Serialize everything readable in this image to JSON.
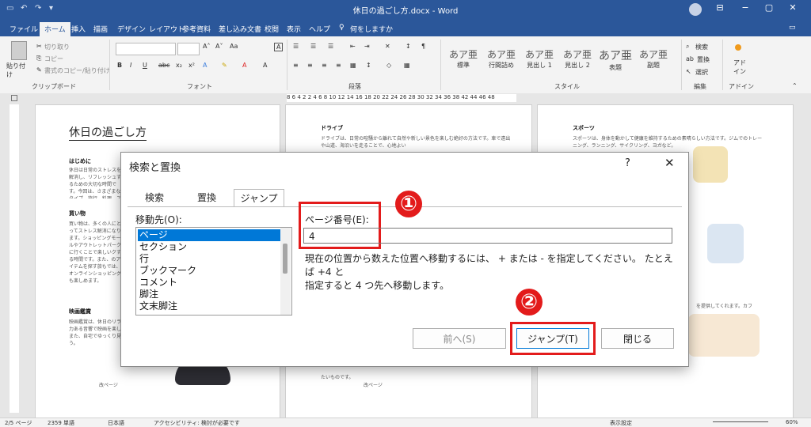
{
  "titlebar": {
    "title": "休日の過ごし方.docx - Word",
    "save_icon": "save-icon",
    "controls": [
      "?",
      "⊟",
      "−",
      "▢",
      "✕"
    ]
  },
  "ribbon_tabs": [
    "ファイル",
    "ホーム",
    "挿入",
    "描画",
    "デザイン",
    "レイアウト",
    "参考資料",
    "差し込み文書",
    "校閲",
    "表示",
    "ヘルプ",
    "何をしますか"
  ],
  "ribbon": {
    "clipboard": {
      "paste": "貼り付け",
      "cut": "切り取り",
      "copy": "コピー",
      "format_painter": "書式のコピー/貼り付け",
      "label": "クリップボード"
    },
    "font": {
      "label": "フォント"
    },
    "paragraph": {
      "label": "段落"
    },
    "styles": {
      "label": "スタイル",
      "items": [
        {
          "sample": "あア亜",
          "name": "標準"
        },
        {
          "sample": "あア亜",
          "name": "行間詰め"
        },
        {
          "sample": "あア亜",
          "name": "見出し 1"
        },
        {
          "sample": "あア亜",
          "name": "見出し 2"
        },
        {
          "sample": "あア亜",
          "name": "表題"
        },
        {
          "sample": "あア亜",
          "name": "副題"
        }
      ]
    },
    "editing": {
      "find": "検索",
      "replace": "置換",
      "select": "選択",
      "label": "編集"
    },
    "addin": {
      "label": "アドイン",
      "name": "アド イン"
    }
  },
  "ruler_numbers": "8 6 4 2   2 4 6 8 10 12 14 16 18 20 22 24 26 28 30 32 34 36 38   42 44 46 48",
  "pages": {
    "left": {
      "title": "休日の過ごし方",
      "h1": "はじめに",
      "p1": "休日は日常のストレスを解消し、リフレッシュするための大切な時間です。今回は、さまざまなタイプ、旅行、料理、スポーツなど、様々な休日の過ごし方をご紹介します。",
      "h2": "買い物",
      "p2": "買い物は、多くの人にとってストレス解消になります。ショッピングモールやアウトレットパークに行くことで楽しいクする時間です。また、のアイテムを探す旅もでは、オンラインショッピングも楽しめます。",
      "h3": "映画鑑賞",
      "p3": "映画鑑賞は、休日のリラックスに最適です。力ある音響で映画を楽しむことができます。また、自宅でゆっくり見るのも良いでしょう。",
      "break": "改ページ"
    },
    "middle": {
      "h1": "ドライブ",
      "p1": "ドライブは、日常の喧騒から離れて自然や新しい景色を楽しむ絶好の方法です。車で遠出や山道、海沿いを走ることで、心地よい",
      "p2": "たいものです。",
      "break": "改ページ"
    },
    "right": {
      "h1": "スポーツ",
      "p1": "スポーツは、身体を動かして健康を維持するための素晴らしい方法です。ジムでのトレーニング、ランニング、サイクリング、ヨガなど。",
      "p2": "を提供してくれます。カフ"
    }
  },
  "dialog": {
    "title": "検索と置換",
    "help": "?",
    "close": "✕",
    "tabs": [
      "検索",
      "置換",
      "ジャンプ"
    ],
    "active_tab": "ジャンプ",
    "goto_label": "移動先(O):",
    "goto_items": [
      "ページ",
      "セクション",
      "行",
      "ブックマーク",
      "コメント",
      "脚注",
      "文末脚注"
    ],
    "selected_item": "ページ",
    "page_label": "ページ番号(E):",
    "page_value": "4",
    "hint_line1": "現在の位置から数えた位置へ移動するには、 + または - を指定してください。 たとえば +4 と",
    "hint_line2": "指定すると 4 つ先へ移動します。",
    "btn_prev": "前へ(S)",
    "btn_goto": "ジャンプ(T)",
    "btn_close": "閉じる"
  },
  "annotations": {
    "step1": "①",
    "step2": "②"
  },
  "status": {
    "page": "2/5 ページ",
    "words": "2359 単語",
    "lang": "日本語",
    "accessibility": "アクセシビリティ: 検討が必要です",
    "display": "表示設定",
    "zoom": "60%"
  },
  "colors": {
    "title_blue": "#2b579a",
    "highlight_red": "#e31b1b",
    "select_blue": "#0078d7"
  }
}
